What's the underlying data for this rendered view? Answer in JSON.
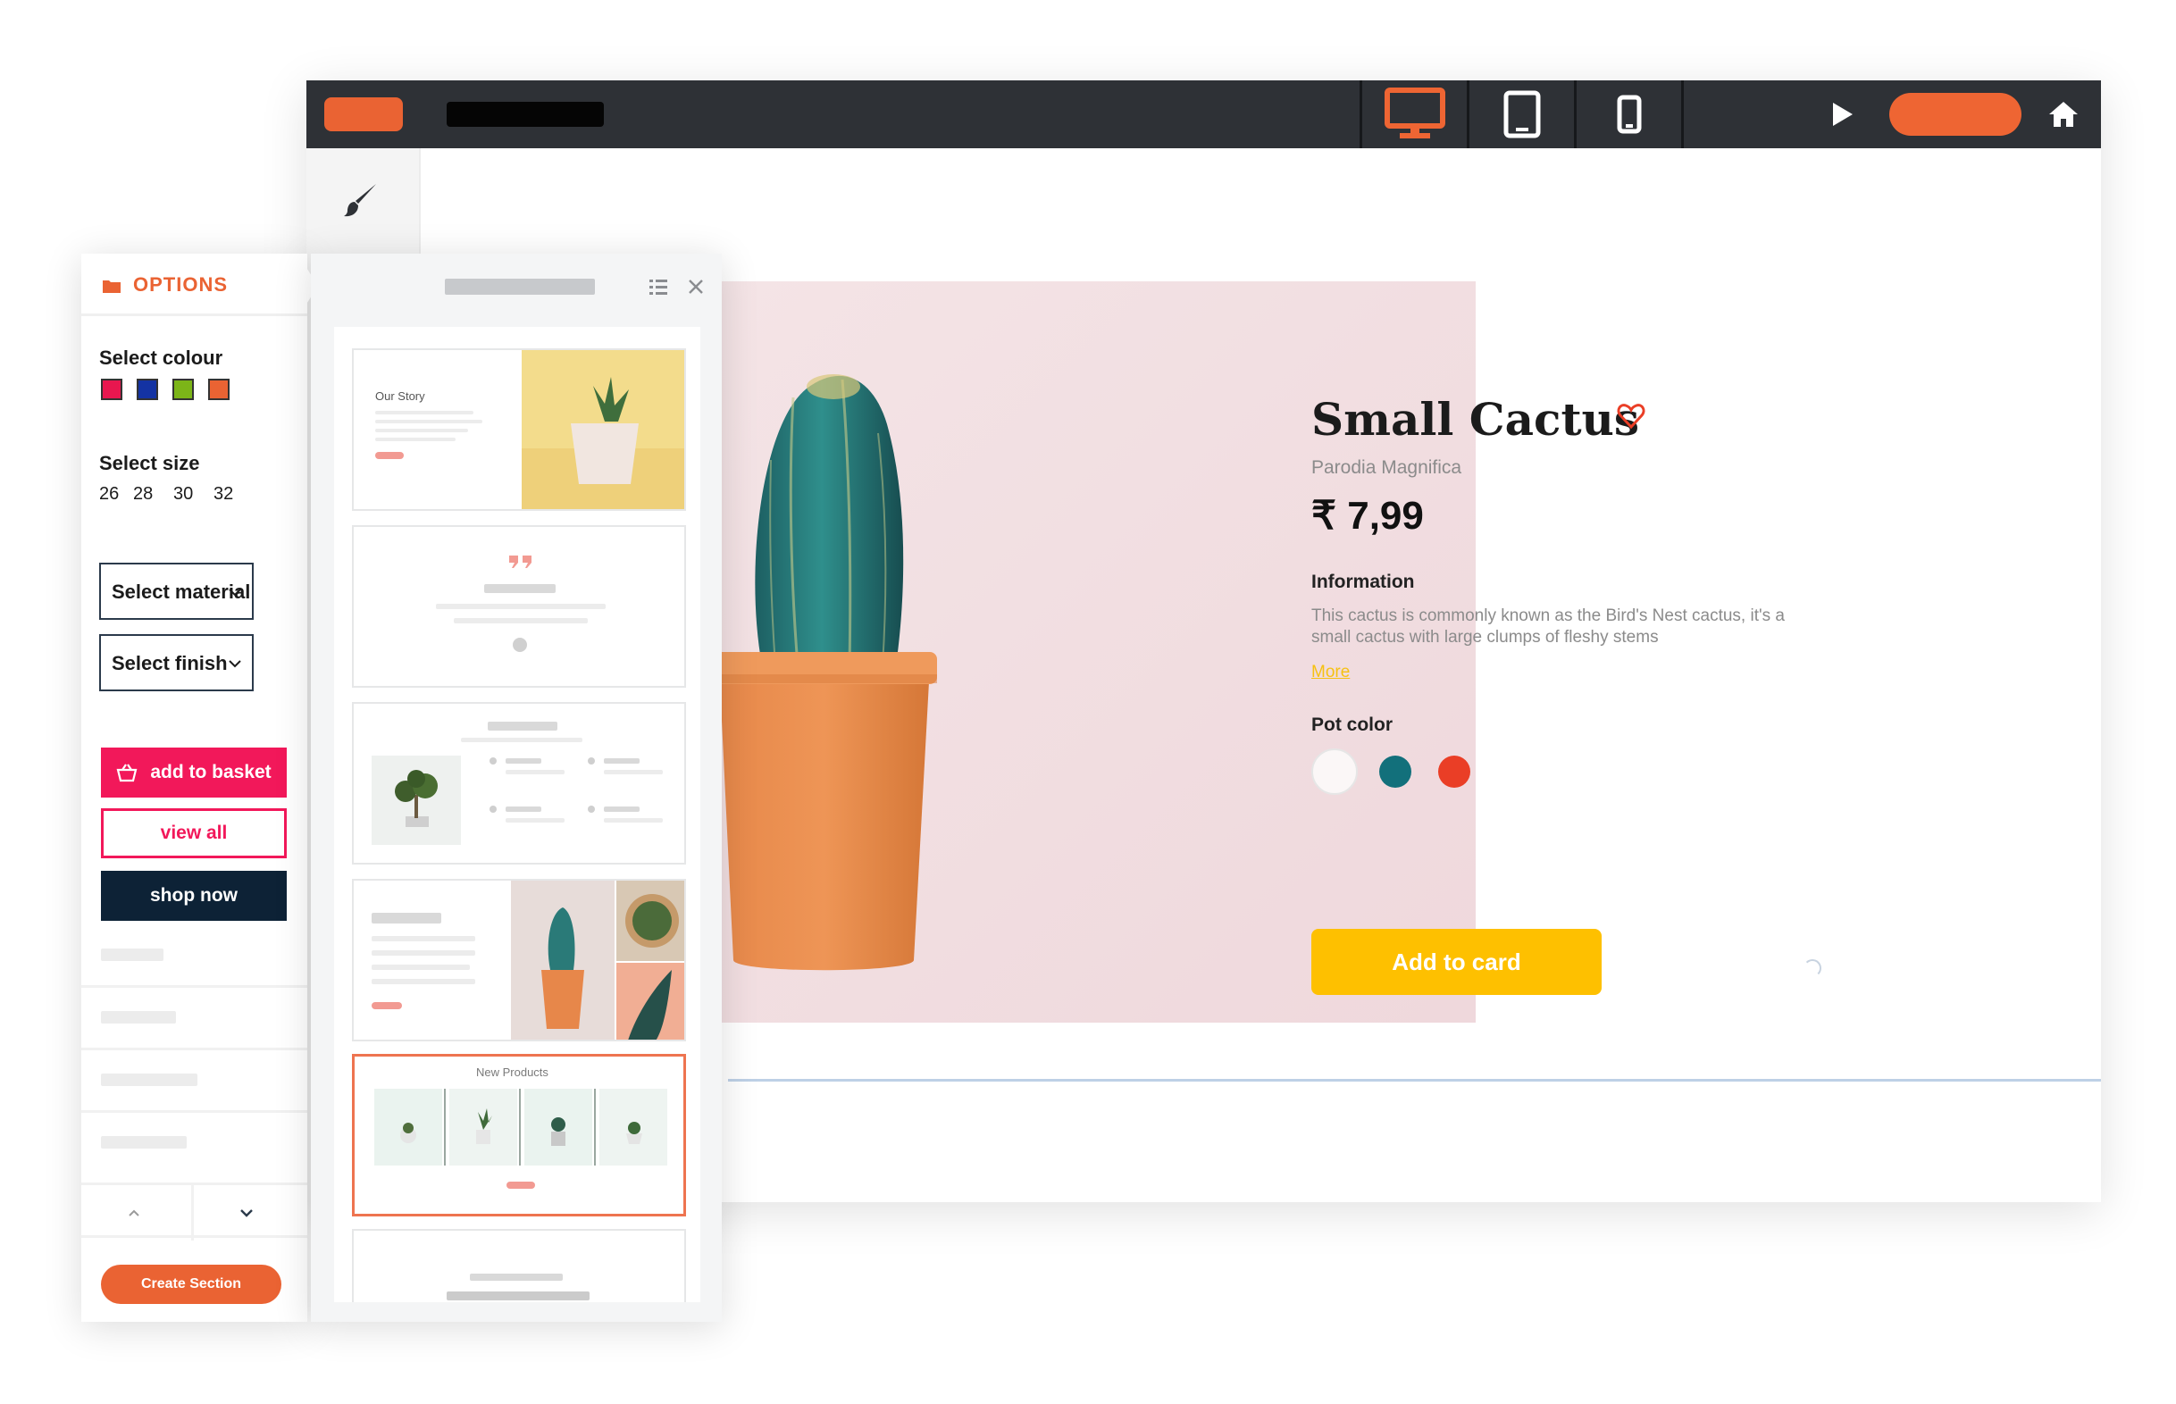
{
  "topbar": {
    "devices": [
      "desktop",
      "tablet",
      "phone"
    ],
    "active_device": "desktop",
    "icons": {
      "preview": "play-icon",
      "home": "home-icon"
    }
  },
  "tools": {
    "brush": "brush-icon"
  },
  "product": {
    "title": "Small Cactus",
    "subtitle": "Parodia Magnifica",
    "price": "₹ 7,99",
    "info_label": "Information",
    "info_text": "This cactus is commonly known as the Bird's Nest cactus, it's a small cactus with large clumps of fleshy stems",
    "more_link": "More",
    "pot_color_label": "Pot color",
    "pot_colors": [
      "#fbf7f7",
      "#12707b",
      "#ea3e26"
    ],
    "add_button": "Add to card"
  },
  "options": {
    "title": "OPTIONS",
    "colour_label": "Select colour",
    "colours": [
      "#e8174f",
      "#1433a3",
      "#7cb518",
      "#ea6333"
    ],
    "size_label": "Select size",
    "sizes": [
      "26",
      "28",
      "30",
      "32"
    ],
    "material_select": "Select material",
    "finish_select": "Select finish",
    "add_basket": "add to basket",
    "view_all": "view all",
    "shop_now": "shop now",
    "create_section": "Create Section"
  },
  "templates": {
    "story_title": "Our Story",
    "new_products_title": "New Products"
  },
  "colors": {
    "accent": "#ea6333",
    "topbar": "#2e3136",
    "cta_yellow": "#fec000",
    "pink": "#f2185a",
    "navy": "#0d2236"
  }
}
